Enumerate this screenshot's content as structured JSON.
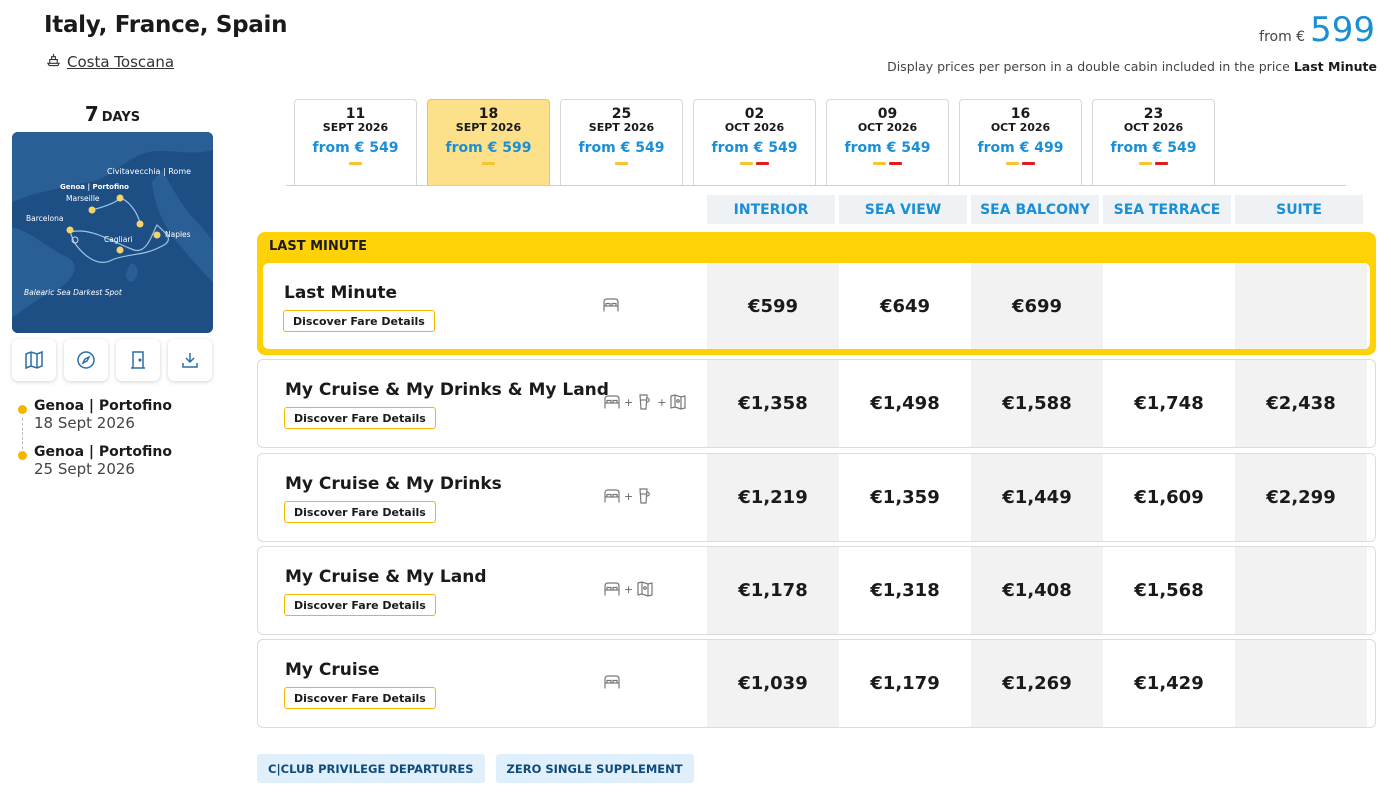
{
  "header": {
    "title": "Italy, France, Spain",
    "ship_name": "Costa Toscana",
    "price_from_label": "from €",
    "price_from_value": "599",
    "display_note_prefix": "Display prices per person in a double cabin included in the price",
    "display_note_fare": "Last Minute"
  },
  "sidebar": {
    "days_number": "7",
    "days_label": "DAYS",
    "map_labels": {
      "genoa": "Genoa | Portofino",
      "marseille": "Marseille",
      "civitavecchia": "Civitavecchia | Rome",
      "barcelona": "Barcelona",
      "cagliari": "Cagliari",
      "naples": "Naples",
      "dark_spot": "Balearic Sea Darkest Spot"
    },
    "map_buttons": [
      "map-icon",
      "compass-icon",
      "door-icon",
      "download-icon"
    ],
    "itinerary": [
      {
        "port": "Genoa | Portofino",
        "date": "18 Sept 2026"
      },
      {
        "port": "Genoa | Portofino",
        "date": "25 Sept 2026"
      }
    ]
  },
  "departures": [
    {
      "day": "11",
      "month": "SEPT 2026",
      "price": "from € 549",
      "marks": [
        "y"
      ],
      "selected": false
    },
    {
      "day": "18",
      "month": "SEPT 2026",
      "price": "from € 599",
      "marks": [
        "y"
      ],
      "selected": true
    },
    {
      "day": "25",
      "month": "SEPT 2026",
      "price": "from € 549",
      "marks": [
        "y"
      ],
      "selected": false
    },
    {
      "day": "02",
      "month": "OCT 2026",
      "price": "from € 549",
      "marks": [
        "y",
        "r"
      ],
      "selected": false
    },
    {
      "day": "09",
      "month": "OCT 2026",
      "price": "from € 549",
      "marks": [
        "y",
        "r"
      ],
      "selected": false
    },
    {
      "day": "16",
      "month": "OCT 2026",
      "price": "from € 499",
      "marks": [
        "y",
        "r"
      ],
      "selected": false
    },
    {
      "day": "23",
      "month": "OCT 2026",
      "price": "from € 549",
      "marks": [
        "y",
        "r"
      ],
      "selected": false
    }
  ],
  "cabin_types": [
    "INTERIOR",
    "SEA VIEW",
    "SEA BALCONY",
    "SEA TERRACE",
    "SUITE"
  ],
  "last_minute_label": "LAST MINUTE",
  "discover_label": "Discover Fare Details",
  "fares": [
    {
      "name": "Last Minute",
      "icons": [
        "cabin-icon"
      ],
      "prices": [
        "€599",
        "€649",
        "€699",
        "",
        ""
      ]
    },
    {
      "name": "My Cruise & My Drinks & My Land",
      "icons": [
        "cabin-icon",
        "drinks-icon",
        "excursion-map-icon"
      ],
      "prices": [
        "€1,358",
        "€1,498",
        "€1,588",
        "€1,748",
        "€2,438"
      ]
    },
    {
      "name": "My Cruise & My Drinks",
      "icons": [
        "cabin-icon",
        "drinks-icon"
      ],
      "prices": [
        "€1,219",
        "€1,359",
        "€1,449",
        "€1,609",
        "€2,299"
      ]
    },
    {
      "name": "My Cruise & My Land",
      "icons": [
        "cabin-icon",
        "excursion-map-icon"
      ],
      "prices": [
        "€1,178",
        "€1,318",
        "€1,408",
        "€1,568",
        ""
      ]
    },
    {
      "name": "My Cruise",
      "icons": [
        "cabin-icon"
      ],
      "prices": [
        "€1,039",
        "€1,179",
        "€1,269",
        "€1,429",
        ""
      ]
    }
  ],
  "tags": [
    "C|CLUB PRIVILEGE DEPARTURES",
    "ZERO SINGLE SUPPLEMENT"
  ],
  "colors": {
    "accent_blue": "#1a8fd6",
    "yellow": "#fed207",
    "selected_date": "#fce08a",
    "red_mark": "#e21b1b"
  }
}
